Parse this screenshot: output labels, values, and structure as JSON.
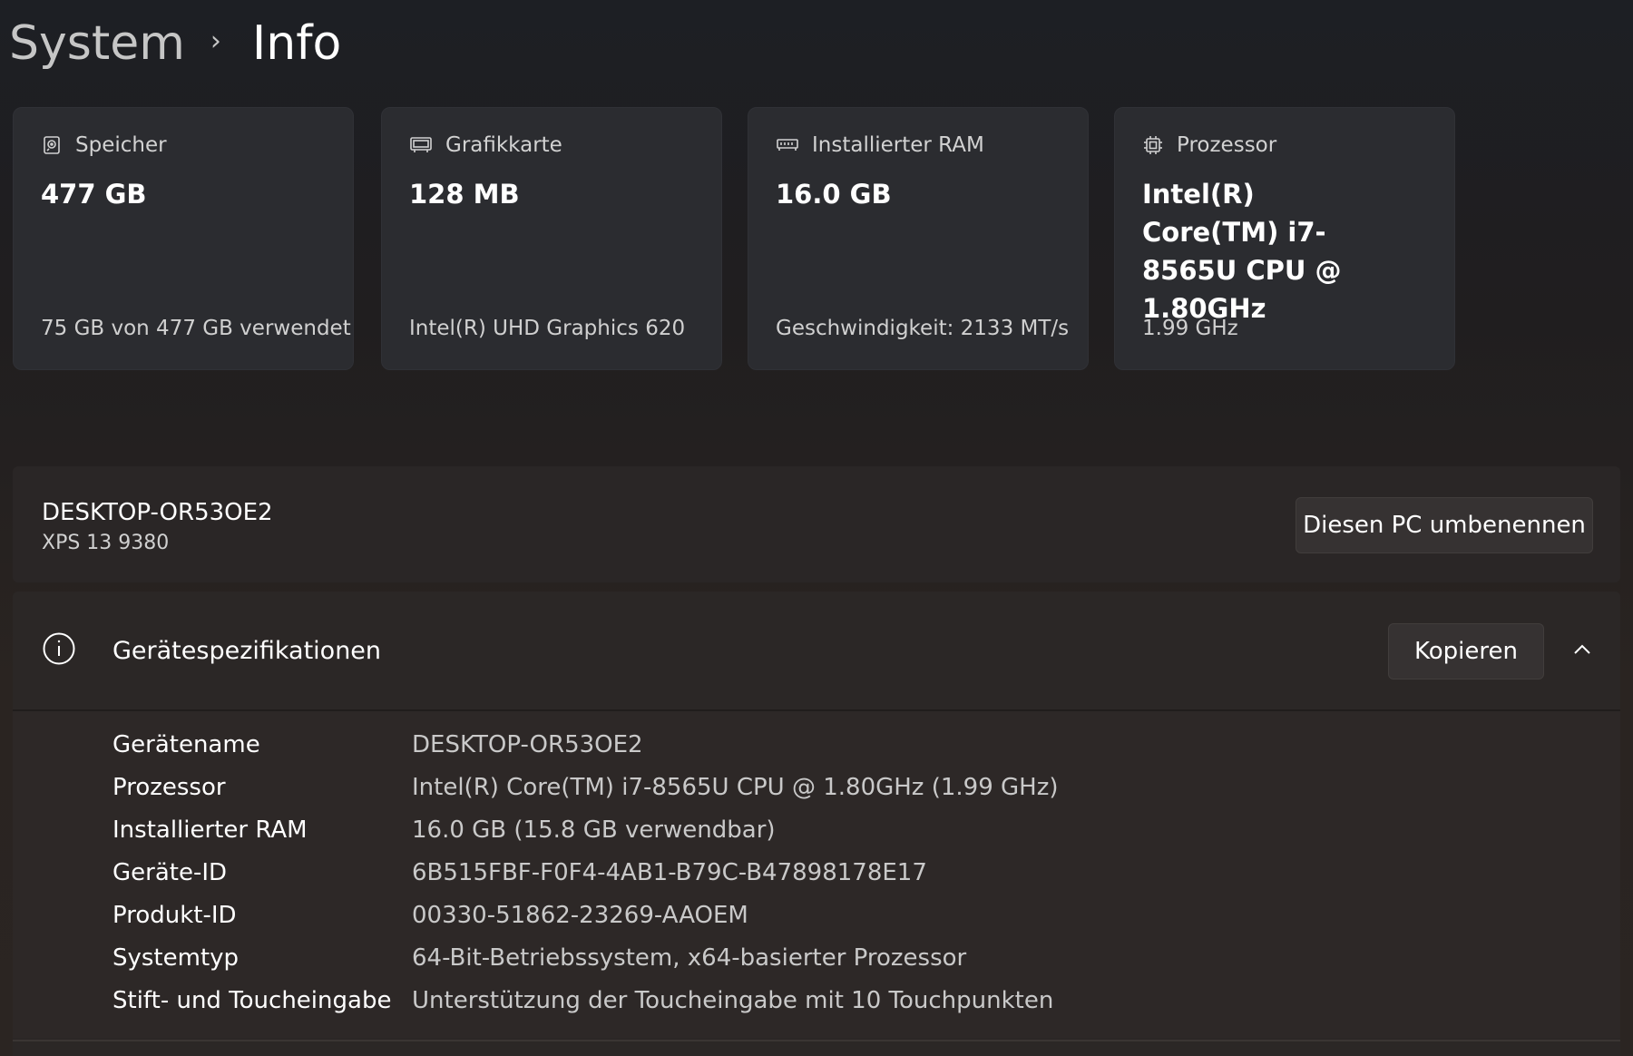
{
  "breadcrumb": {
    "parent": "System",
    "separator": "›",
    "current": "Info"
  },
  "cards": [
    {
      "icon": "storage-icon",
      "label": "Speicher",
      "value": "477 GB",
      "sub": "75 GB von 477 GB verwendet"
    },
    {
      "icon": "graphics-card-icon",
      "label": "Grafikkarte",
      "value": "128 MB",
      "sub": "Intel(R) UHD Graphics 620"
    },
    {
      "icon": "ram-icon",
      "label": "Installierter RAM",
      "value": "16.0 GB",
      "sub": "Geschwindigkeit: 2133 MT/s"
    },
    {
      "icon": "processor-icon",
      "label": "Prozessor",
      "value": "Intel(R) Core(TM) i7-8565U CPU @ 1.80GHz",
      "sub": "1.99 GHz"
    }
  ],
  "device": {
    "name": "DESKTOP-OR53OE2",
    "model": "XPS 13 9380",
    "rename_button": "Diesen PC umbenennen"
  },
  "specs": {
    "title": "Gerätespezifikationen",
    "copy_button": "Kopieren",
    "rows": [
      {
        "label": "Gerätename",
        "value": "DESKTOP-OR53OE2"
      },
      {
        "label": "Prozessor",
        "value": "Intel(R) Core(TM) i7-8565U CPU @ 1.80GHz (1.99 GHz)"
      },
      {
        "label": "Installierter RAM",
        "value": "16.0 GB (15.8 GB verwendbar)"
      },
      {
        "label": "Geräte-ID",
        "value": "6B515FBF-F0F4-4AB1-B79C-B47898178E17"
      },
      {
        "label": "Produkt-ID",
        "value": "00330-51862-23269-AAOEM"
      },
      {
        "label": "Systemtyp",
        "value": "64-Bit-Betriebssystem, x64-basierter Prozessor"
      },
      {
        "label": "Stift- und Toucheingabe",
        "value": "Unterstützung der Toucheingabe mit 10 Touchpunkten"
      }
    ]
  }
}
